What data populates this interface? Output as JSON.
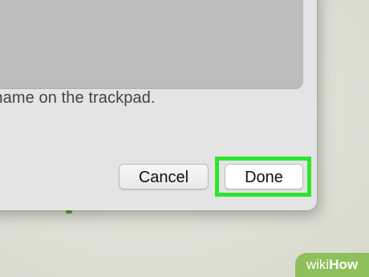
{
  "dialog": {
    "instruction": "r name on the trackpad.",
    "cancel_label": "Cancel",
    "done_label": "Done"
  },
  "watermark": {
    "wiki": "wiki",
    "how": "How"
  },
  "colors": {
    "highlight": "#2ee62e",
    "watermark": "#8fbf5a"
  }
}
